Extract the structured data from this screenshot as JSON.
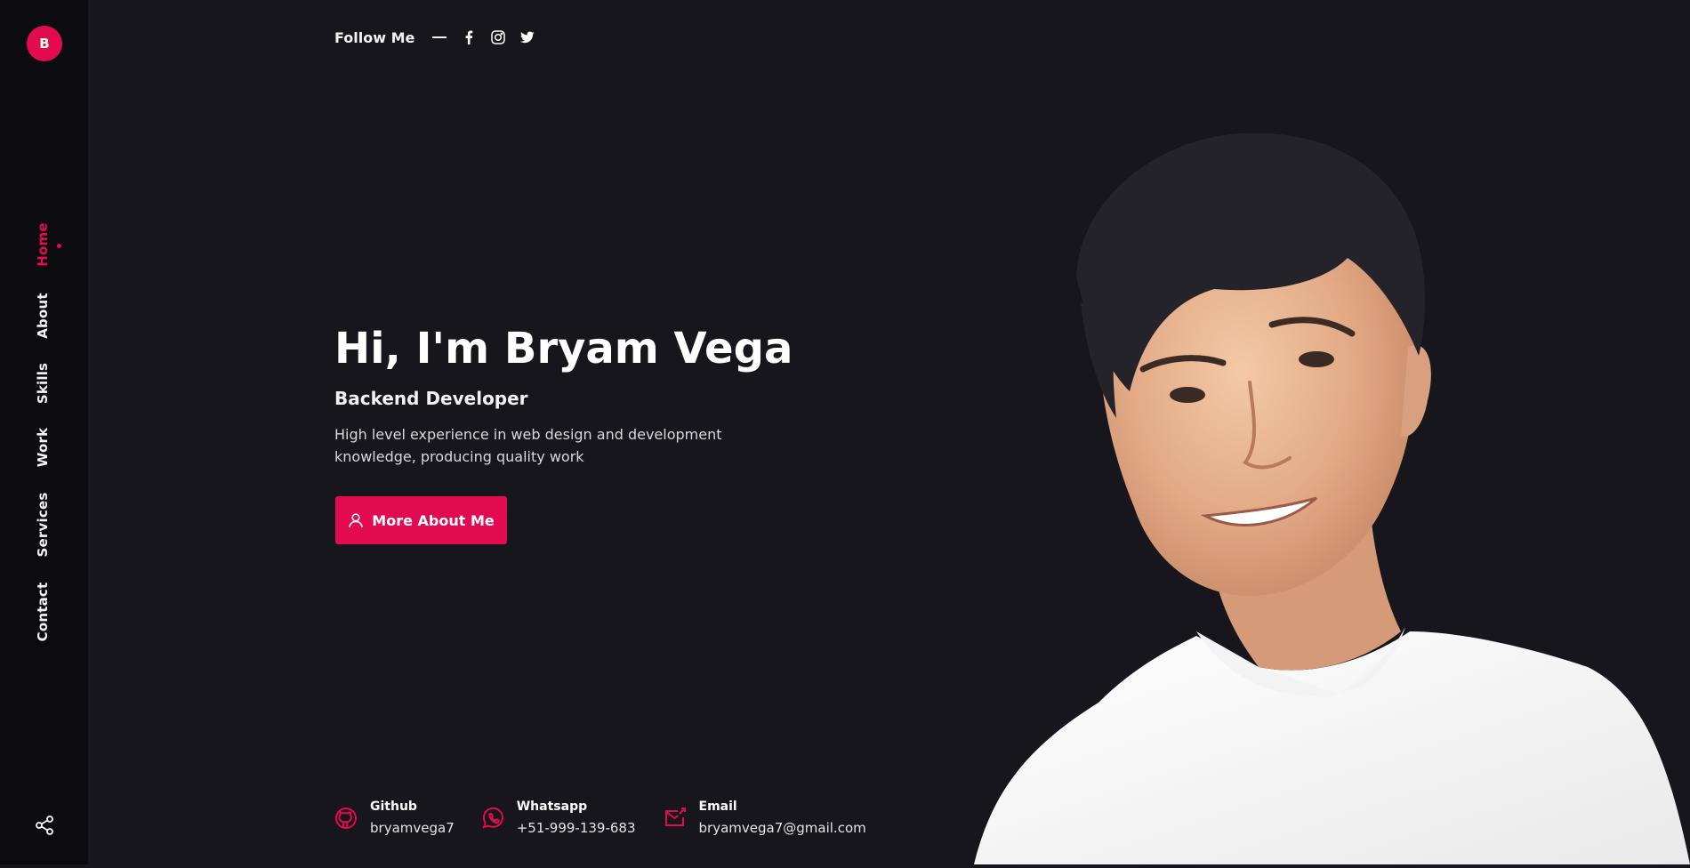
{
  "sidebar": {
    "logo_letter": "B",
    "nav": [
      {
        "label": "Home"
      },
      {
        "label": "About"
      },
      {
        "label": "Skills"
      },
      {
        "label": "Work"
      },
      {
        "label": "Services"
      },
      {
        "label": "Contact"
      }
    ],
    "share_icon": "share-icon"
  },
  "header": {
    "follow_label": "Follow Me",
    "socials": [
      "facebook-icon",
      "instagram-icon",
      "twitter-icon"
    ]
  },
  "hero": {
    "title": "Hi, I'm Bryam Vega",
    "subtitle": "Backend Developer",
    "description": "High level experience in web design and development knowledge, producing quality work",
    "button_label": "More About Me",
    "button_icon": "user-icon"
  },
  "contacts": [
    {
      "title": "Github",
      "value": "bryamvega7",
      "icon": "github-icon"
    },
    {
      "title": "Whatsapp",
      "value": "+51-999-139-683",
      "icon": "whatsapp-icon"
    },
    {
      "title": "Email",
      "value": "bryamvega7@gmail.com",
      "icon": "email-icon"
    }
  ],
  "colors": {
    "accent": "#e30b4f",
    "background": "#16161c",
    "sidebar": "#0b0b10"
  }
}
